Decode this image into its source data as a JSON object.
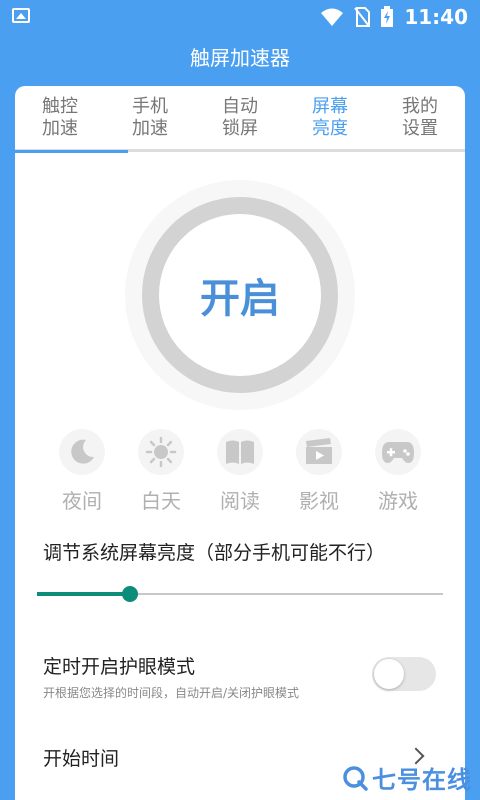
{
  "status_bar": {
    "time": "11:40",
    "icons": [
      "gallery-icon",
      "wifi-icon",
      "no-sim-icon",
      "battery-charging-icon"
    ]
  },
  "app": {
    "title": "触屏加速器"
  },
  "tabs": [
    {
      "label": "触控加速",
      "active": false
    },
    {
      "label": "手机加速",
      "active": false
    },
    {
      "label": "自动锁屏",
      "active": false
    },
    {
      "label": "屏幕亮度",
      "active": true
    },
    {
      "label": "我的设置",
      "active": false
    }
  ],
  "power": {
    "label": "开启"
  },
  "modes": [
    {
      "label": "夜间",
      "icon": "moon-icon"
    },
    {
      "label": "白天",
      "icon": "sun-icon"
    },
    {
      "label": "阅读",
      "icon": "book-icon"
    },
    {
      "label": "影视",
      "icon": "film-icon"
    },
    {
      "label": "游戏",
      "icon": "gamepad-icon"
    }
  ],
  "brightness": {
    "label": "调节系统屏幕亮度（部分手机可能不行）",
    "value": 0.23
  },
  "eye_protection": {
    "title": "定时开启护眼模式",
    "description": "开根据您选择的时间段，自动开启/关闭护眼模式",
    "enabled": false
  },
  "start_time": {
    "label": "开始时间"
  },
  "watermark": {
    "text": "七号在线"
  },
  "colors": {
    "primary": "#4a9ff0",
    "accent_teal": "#0e8c7a",
    "ring_gray": "#d3d3d3",
    "mode_gray": "#b0b0b0"
  }
}
